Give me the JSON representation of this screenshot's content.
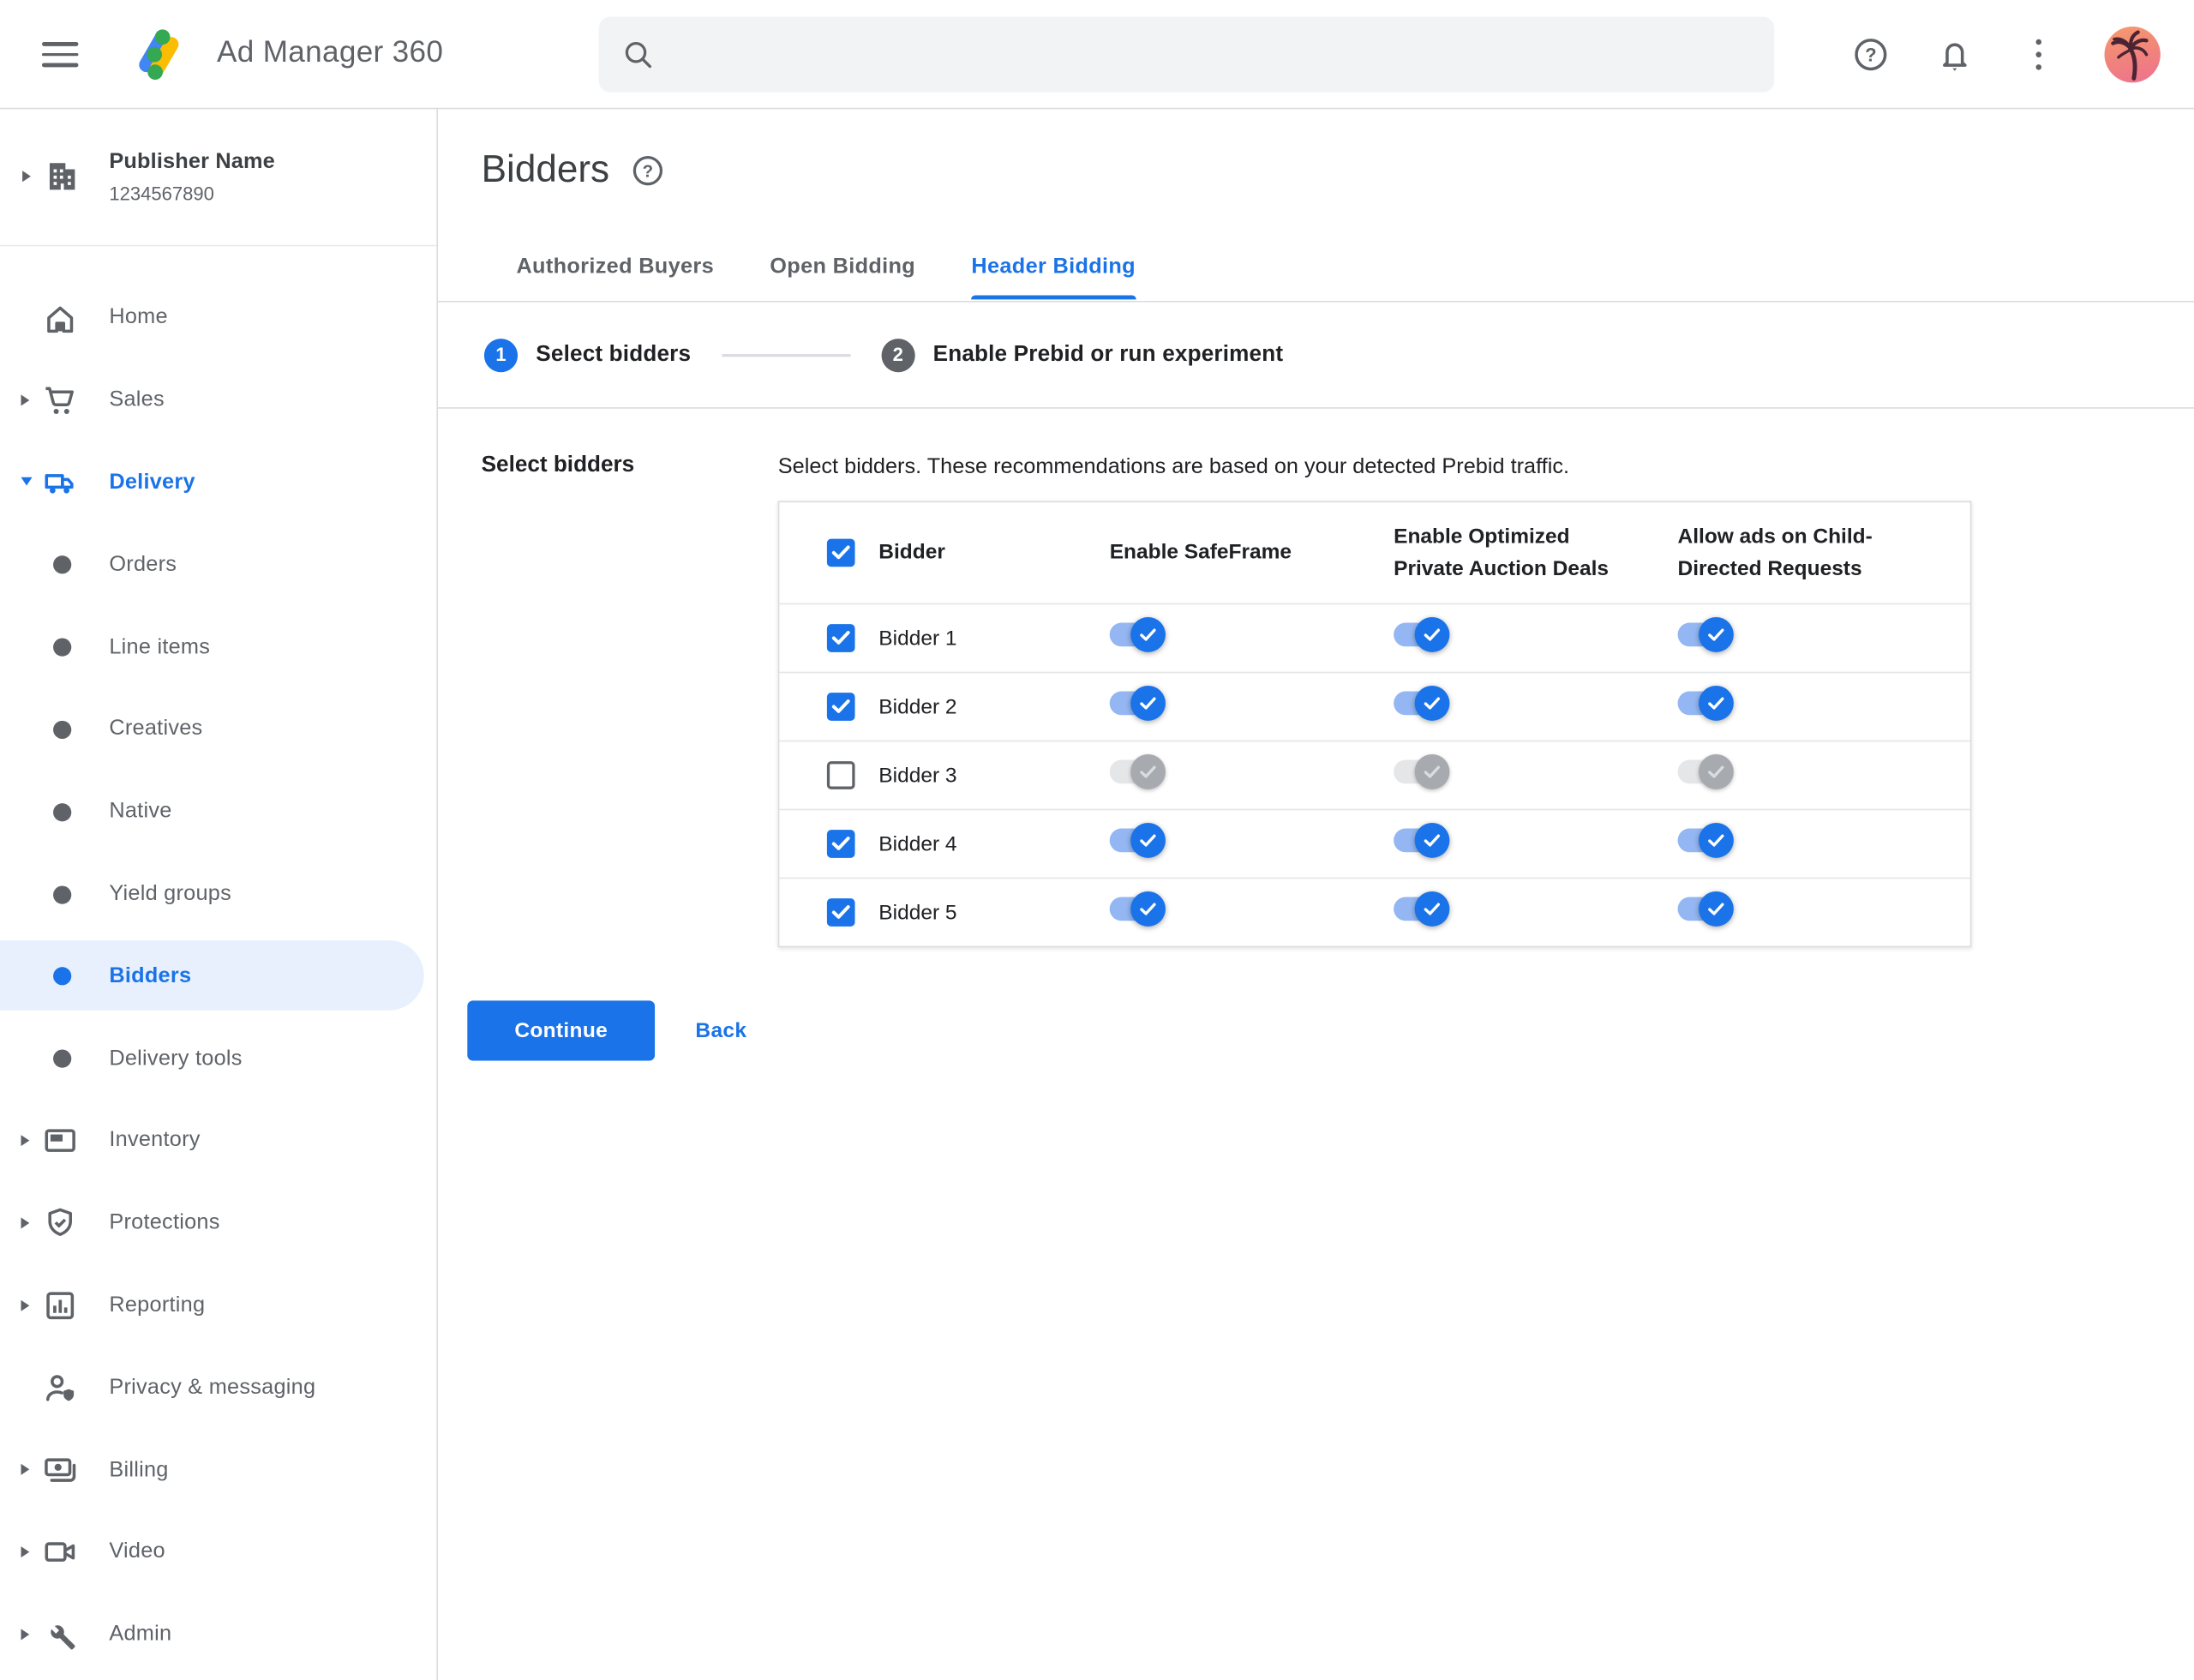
{
  "topbar": {
    "product_name": "Ad Manager 360",
    "search_value": ""
  },
  "sidebar": {
    "publisher_name": "Publisher Name",
    "publisher_id": "1234567890",
    "items": [
      {
        "label": "Home",
        "icon": "home"
      },
      {
        "label": "Sales",
        "icon": "cart",
        "expandable": true
      },
      {
        "label": "Delivery",
        "icon": "truck",
        "expandable": true,
        "expanded": true,
        "active": true
      },
      {
        "label": "Orders",
        "bullet": true
      },
      {
        "label": "Line items",
        "bullet": true
      },
      {
        "label": "Creatives",
        "bullet": true
      },
      {
        "label": "Native",
        "bullet": true
      },
      {
        "label": "Yield groups",
        "bullet": true
      },
      {
        "label": "Bidders",
        "bullet": true,
        "selected": true
      },
      {
        "label": "Delivery tools",
        "bullet": true
      },
      {
        "label": "Inventory",
        "icon": "inventory",
        "expandable": true
      },
      {
        "label": "Protections",
        "icon": "shield",
        "expandable": true
      },
      {
        "label": "Reporting",
        "icon": "report",
        "expandable": true
      },
      {
        "label": "Privacy & messaging",
        "icon": "privacy"
      },
      {
        "label": "Billing",
        "icon": "billing",
        "expandable": true
      },
      {
        "label": "Video",
        "icon": "video",
        "expandable": true
      },
      {
        "label": "Admin",
        "icon": "wrench",
        "expandable": true
      }
    ]
  },
  "page": {
    "title": "Bidders",
    "tabs": [
      {
        "label": "Authorized Buyers",
        "active": false
      },
      {
        "label": "Open Bidding",
        "active": false
      },
      {
        "label": "Header Bidding",
        "active": true
      }
    ],
    "steps": [
      {
        "number": "1",
        "label": "Select bidders",
        "state": "current"
      },
      {
        "number": "2",
        "label": "Enable Prebid or run experiment",
        "state": "upcoming"
      }
    ],
    "section_label": "Select bidders",
    "description": "Select bidders. These recommendations are based on your detected Prebid traffic.",
    "table": {
      "header_checkbox_checked": true,
      "columns": [
        "Bidder",
        "Enable SafeFrame",
        "Enable Optimized Private Auction Deals",
        "Allow ads on Child-Directed Requests"
      ],
      "rows": [
        {
          "name": "Bidder 1",
          "selected": true,
          "enable_safeframe": true,
          "enable_optimized_private_auction_deals": true,
          "allow_ads_on_child_directed_requests": true
        },
        {
          "name": "Bidder 2",
          "selected": true,
          "enable_safeframe": true,
          "enable_optimized_private_auction_deals": true,
          "allow_ads_on_child_directed_requests": true
        },
        {
          "name": "Bidder 3",
          "selected": false,
          "enable_safeframe": false,
          "enable_optimized_private_auction_deals": false,
          "allow_ads_on_child_directed_requests": false
        },
        {
          "name": "Bidder 4",
          "selected": true,
          "enable_safeframe": true,
          "enable_optimized_private_auction_deals": true,
          "allow_ads_on_child_directed_requests": true
        },
        {
          "name": "Bidder 5",
          "selected": true,
          "enable_safeframe": true,
          "enable_optimized_private_auction_deals": true,
          "allow_ads_on_child_directed_requests": true
        }
      ]
    },
    "actions": {
      "continue_label": "Continue",
      "back_label": "Back"
    }
  },
  "colors": {
    "accent_blue": "#1a73e8",
    "toggle_track_on": "#94b7f3",
    "selected_item_bg": "#e8f0fe",
    "grey_icon": "#5f6368",
    "divider": "#dadce0"
  }
}
